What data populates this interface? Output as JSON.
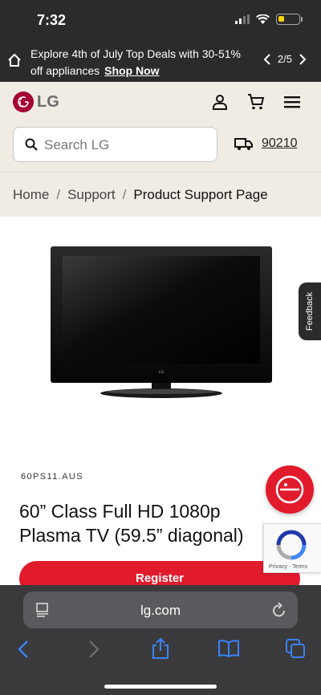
{
  "status": {
    "time": "7:32",
    "battery_level": 0.3,
    "battery_color": "#f5d60a"
  },
  "promo": {
    "text": "Explore 4th of July Top Deals with 30-51% off appliances",
    "link": "Shop Now",
    "pager": "2/5"
  },
  "header": {
    "logo_text": "LG",
    "brand_color": "#a50034",
    "search_placeholder": "Search LG",
    "zip": "90210",
    "icons": [
      "user-icon",
      "cart-icon",
      "menu-icon"
    ]
  },
  "breadcrumb": {
    "items": [
      "Home",
      "Support"
    ],
    "current": "Product Support Page"
  },
  "feedback_label": "Feedback",
  "product": {
    "model": "60PS11.AUS",
    "title_line1": "60” Class Full HD 1080p",
    "title_line2": "Plasma TV (59.5” diagonal)",
    "register_label": "Register",
    "accent_color": "#e21b2c"
  },
  "recaptcha": {
    "privacy": "Privacy",
    "terms": "Terms"
  },
  "browser": {
    "url": "lg.com"
  }
}
